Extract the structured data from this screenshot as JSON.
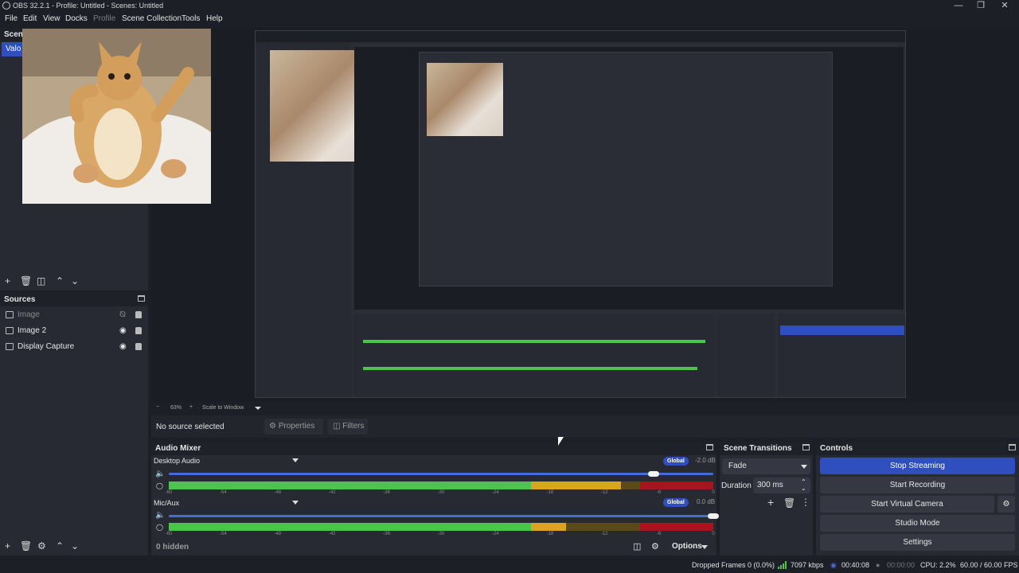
{
  "window": {
    "title": "OBS 32.2.1 - Profile: Untitled - Scenes: Untitled"
  },
  "menu": [
    "File",
    "Edit",
    "View",
    "Docks",
    "Profile",
    "Scene Collection",
    "Tools",
    "Help"
  ],
  "scenes": {
    "title": "Scenes",
    "items": [
      "Valo"
    ]
  },
  "sources": {
    "title": "Sources",
    "items": [
      {
        "label": "Image",
        "hidden": true
      },
      {
        "label": "Image 2",
        "hidden": false
      },
      {
        "label": "Display Capture",
        "hidden": false
      }
    ]
  },
  "zoom": {
    "level": "63%",
    "mode": "Scale to Window"
  },
  "properties_bar": {
    "no_source": "No source selected",
    "properties": "Properties",
    "filters": "Filters"
  },
  "audio_mixer": {
    "title": "Audio Mixer",
    "channels": [
      {
        "name": "Desktop Audio",
        "global": "Global",
        "db": "-2.0 dB",
        "volume": 0.89,
        "level": 0.83
      },
      {
        "name": "Mic/Aux",
        "global": "Global",
        "db": "0.0 dB",
        "volume": 1.0,
        "level": 0.73
      }
    ],
    "ticks": [
      "-60",
      "-54",
      "-48",
      "-42",
      "-36",
      "-30",
      "-24",
      "-18",
      "-12",
      "-6",
      "0"
    ],
    "hidden": "0 hidden",
    "options": "Options"
  },
  "scene_transitions": {
    "title": "Scene Transitions",
    "transition": "Fade",
    "duration_label": "Duration",
    "duration": "300 ms"
  },
  "controls": {
    "title": "Controls",
    "buttons": [
      "Stop Streaming",
      "Start Recording",
      "Start Virtual Camera",
      "Studio Mode",
      "Settings"
    ]
  },
  "status": {
    "dropped": "Dropped Frames 0 (0.0%)",
    "bitrate": "7097 kbps",
    "stream_time": "00:40:08",
    "rec_time": "00:00:00",
    "cpu": "CPU: 2.2%",
    "fps": "60.00 / 60.00 FPS"
  },
  "colors": {
    "accent": "#2f4fbf",
    "meter_green": "#4cc34c",
    "meter_yellow": "#d9a41e",
    "meter_red": "#a8141e"
  }
}
